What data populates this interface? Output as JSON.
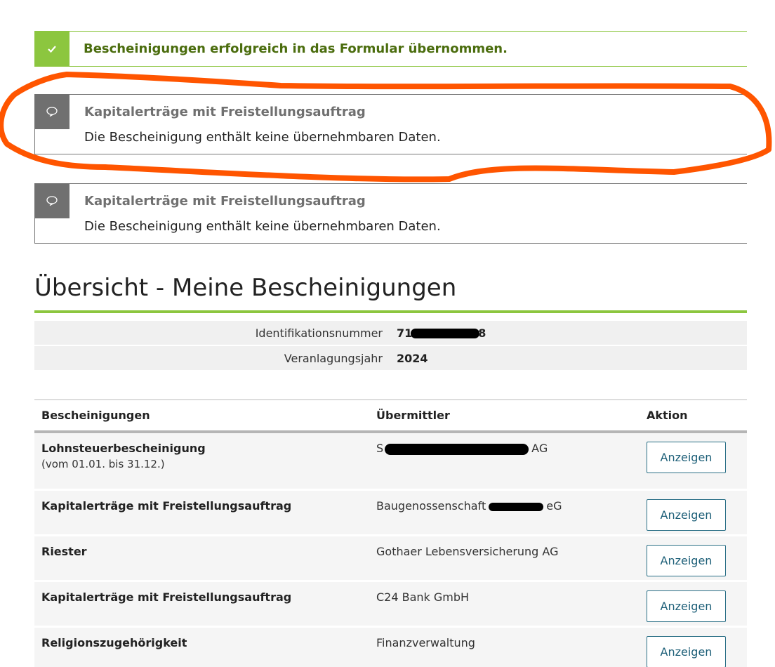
{
  "success_notice": {
    "message": "Bescheinigungen erfolgreich in das Formular übernommen."
  },
  "info_notices": [
    {
      "title": "Kapitalerträge mit Freistellungsauftrag",
      "text": "Die Bescheinigung enthält keine übernehmbaren Daten."
    },
    {
      "title": "Kapitalerträge mit Freistellungsauftrag",
      "text": "Die Bescheinigung enthält keine übernehmbaren Daten."
    }
  ],
  "section": {
    "title": "Übersicht - Meine Bescheinigungen"
  },
  "info": {
    "id_label": "Identifikationsnummer",
    "id_prefix": "71",
    "id_suffix": "8",
    "year_label": "Veranlagungsjahr",
    "year_value": "2024"
  },
  "table": {
    "headers": {
      "documents": "Bescheinigungen",
      "sender": "Übermittler",
      "action": "Aktion"
    },
    "rows": [
      {
        "name": "Lohnsteuerbescheinigung",
        "sub": "(vom 01.01. bis 31.12.)",
        "sender_prefix": "S",
        "sender_suffix": "AG",
        "action": "Anzeigen"
      },
      {
        "name": "Kapitalerträge mit Freistellungsauftrag",
        "sender_prefix": "Baugenossenschaft",
        "sender_suffix": "eG",
        "action": "Anzeigen"
      },
      {
        "name": "Riester",
        "sender": "Gothaer Lebensversicherung AG",
        "action": "Anzeigen"
      },
      {
        "name": "Kapitalerträge mit Freistellungsauftrag",
        "sender": "C24 Bank GmbH",
        "action": "Anzeigen"
      },
      {
        "name": "Religionszugehörigkeit",
        "sender": "Finanzverwaltung",
        "action": "Anzeigen"
      }
    ]
  },
  "colors": {
    "accent_green": "#8cc63f",
    "success_text": "#4b6d0e",
    "info_gray": "#707070",
    "button_teal": "#1d5f78",
    "annotation_orange": "#ff5500"
  },
  "icons": {
    "success": "check-icon",
    "info": "speech-bubble-icon"
  }
}
